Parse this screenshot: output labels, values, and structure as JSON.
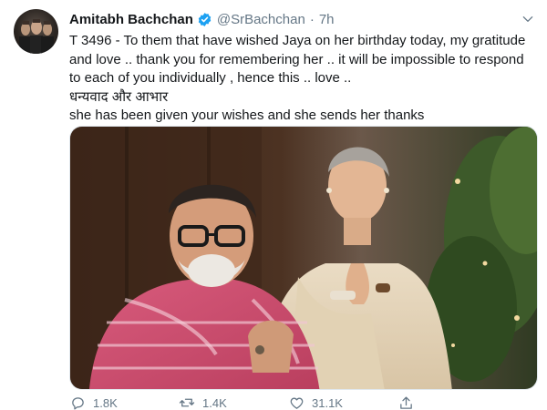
{
  "tweet": {
    "author_name": "Amitabh Bachchan",
    "handle": "@SrBachchan",
    "separator": "·",
    "time": "7h",
    "text_line1": "T 3496 - To them that have wished Jaya on her birthday today, my gratitude and love .. thank you for remembering her .. it will be impossible to respond to each of you individually , hence this .. love ..",
    "text_line2": "धन्यवाद और आभार",
    "text_line3": "she has been given your wishes and she sends her thanks",
    "media_alt": "photo",
    "verified_icon": "verified-badge-icon",
    "caret_icon": "chevron-down-icon"
  },
  "actions": {
    "reply_count": "1.8K",
    "retweet_count": "1.4K",
    "like_count": "31.1K",
    "reply_icon": "reply-icon",
    "retweet_icon": "retweet-icon",
    "like_icon": "heart-icon",
    "share_icon": "share-icon"
  },
  "colors": {
    "verified_blue": "#1da1f2",
    "secondary_text": "#657786",
    "primary_text": "#14171a"
  }
}
